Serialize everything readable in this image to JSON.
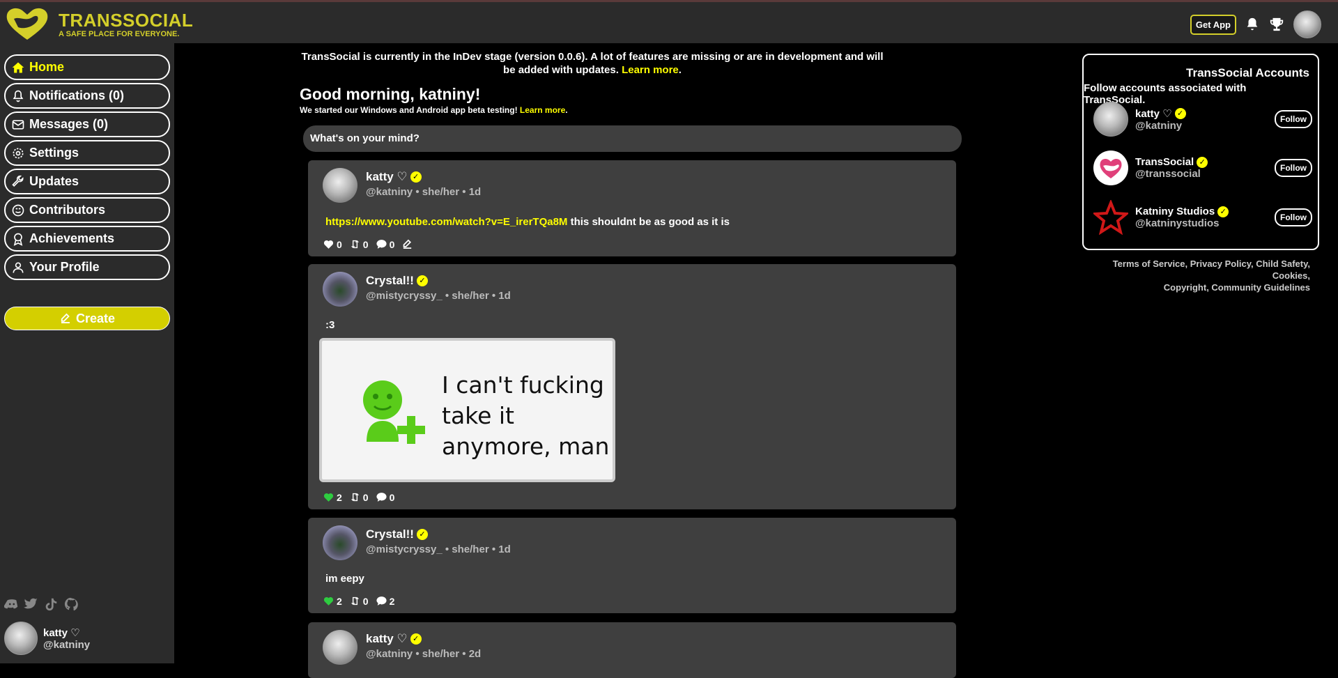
{
  "brand": {
    "name": "TRANSSOCIAL",
    "tagline": "A SAFE PLACE FOR EVERYONE."
  },
  "topbar": {
    "get_app": "Get App"
  },
  "nav": {
    "home": "Home",
    "notifications": "Notifications (0)",
    "messages": "Messages (0)",
    "settings": "Settings",
    "updates": "Updates",
    "contributors": "Contributors",
    "achievements": "Achievements",
    "profile": "Your Profile",
    "create": "Create"
  },
  "sidebar_user": {
    "name": "katty ♡",
    "handle": "@katniny"
  },
  "notice": {
    "text": "TransSocial is currently in the InDev stage (version 0.0.6). A lot of features are missing or are in development and will be added with updates.",
    "link": "Learn more"
  },
  "greeting": {
    "title": "Good morning, katniny!",
    "subtitle": "We started our Windows and Android app beta testing!",
    "link": "Learn more"
  },
  "composer": {
    "placeholder": "What's on your mind?"
  },
  "posts": [
    {
      "name": "katty ♡",
      "handle": "@katniny",
      "pronouns": "she/her",
      "time": "1d",
      "link": "https://www.youtube.com/watch?v=E_irerTQa8M",
      "text": "this shouldnt be as good as it is",
      "likes": "0",
      "reposts": "0",
      "comments": "0"
    },
    {
      "name": "Crystal!!",
      "handle": "@mistycryssy_",
      "pronouns": "she/her",
      "time": "1d",
      "text": ":3",
      "image_text": "I can't fucking take it anymore, man",
      "likes": "2",
      "reposts": "0",
      "comments": "0"
    },
    {
      "name": "Crystal!!",
      "handle": "@mistycryssy_",
      "pronouns": "she/her",
      "time": "1d",
      "text": "im eepy",
      "likes": "2",
      "reposts": "0",
      "comments": "2"
    },
    {
      "name": "katty ♡",
      "handle": "@katniny",
      "pronouns": "she/her",
      "time": "2d"
    }
  ],
  "accounts_panel": {
    "title": "TransSocial Accounts",
    "description": "Follow accounts associated with TransSocial.",
    "follow_label": "Follow",
    "accounts": [
      {
        "name": "katty ♡",
        "handle": "@katniny"
      },
      {
        "name": "TransSocial",
        "handle": "@transsocial"
      },
      {
        "name": "Katniny Studios",
        "handle": "@katninystudios"
      }
    ]
  },
  "footer": {
    "links": [
      "Terms of Service",
      "Privacy Policy",
      "Child Safety",
      "Cookies",
      "Copyright",
      "Community Guidelines"
    ]
  },
  "colors": {
    "accent": "#ffff00",
    "brand": "#d4cf2a",
    "panel": "#2b2b2b",
    "card": "#3f3f3f",
    "like": "#2ecc40"
  }
}
